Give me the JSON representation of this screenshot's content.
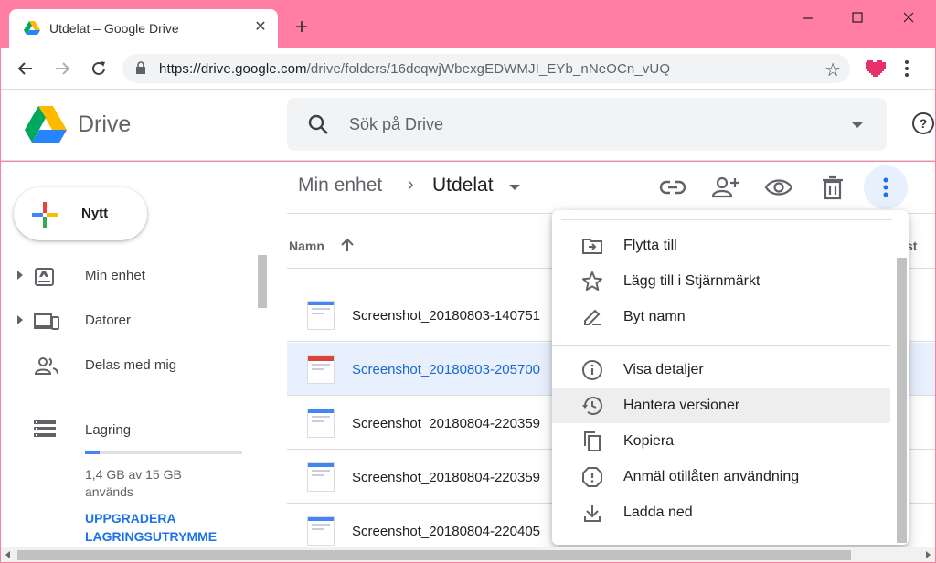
{
  "browser": {
    "tab_title": "Utdelat – Google Drive",
    "tab_close": "✕",
    "new_tab": "+",
    "url_host": "https://drive.google.com",
    "url_path": "/drive/folders/16dcqwjWbexgEDWMJI_EYb_nNeOCn_vUQ",
    "bookmark_icon": "star-outline-icon",
    "menu_icon": "kebab-menu-icon"
  },
  "drive": {
    "app_name": "Drive",
    "search_placeholder": "Sök på Drive",
    "help_icon": "help-icon"
  },
  "sidebar": {
    "new_label": "Nytt",
    "items": [
      {
        "label": "Min enhet",
        "icon": "drive-icon"
      },
      {
        "label": "Datorer",
        "icon": "computers-icon"
      },
      {
        "label": "Delas med mig",
        "icon": "people-icon"
      }
    ],
    "storage_label": "Lagring",
    "storage_text": "1,4 GB av 15 GB används",
    "storage_fraction": 0.093,
    "upgrade_label": "UPPGRADERA LAGRINGSUTRYMME"
  },
  "main": {
    "breadcrumb_root": "Min enhet",
    "breadcrumb_sep": "›",
    "breadcrumb_current": "Utdelat",
    "column_name": "Namn",
    "column_last": "st",
    "files": [
      {
        "name": "Screenshot_20180803-140751",
        "selected": false
      },
      {
        "name": "Screenshot_20180803-205700",
        "selected": true
      },
      {
        "name": "Screenshot_20180804-220359",
        "selected": false
      },
      {
        "name": "Screenshot_20180804-220359",
        "selected": false
      },
      {
        "name": "Screenshot_20180804-220405",
        "selected": false
      }
    ]
  },
  "menu": {
    "items": [
      {
        "label": "Flytta till",
        "icon": "move-to-folder-icon"
      },
      {
        "label": "Lägg till i Stjärnmärkt",
        "icon": "star-icon"
      },
      {
        "label": "Byt namn",
        "icon": "rename-icon"
      },
      {
        "label": "Visa detaljer",
        "icon": "info-icon"
      },
      {
        "label": "Hantera versioner",
        "icon": "history-icon"
      },
      {
        "label": "Kopiera",
        "icon": "copy-icon"
      },
      {
        "label": "Anmäl otillåten användning",
        "icon": "report-icon"
      },
      {
        "label": "Ladda ned",
        "icon": "download-icon"
      }
    ]
  },
  "colors": {
    "frame": "#ff7ea1",
    "accent": "#1a73e8",
    "selected_row": "#e8f0fe"
  }
}
